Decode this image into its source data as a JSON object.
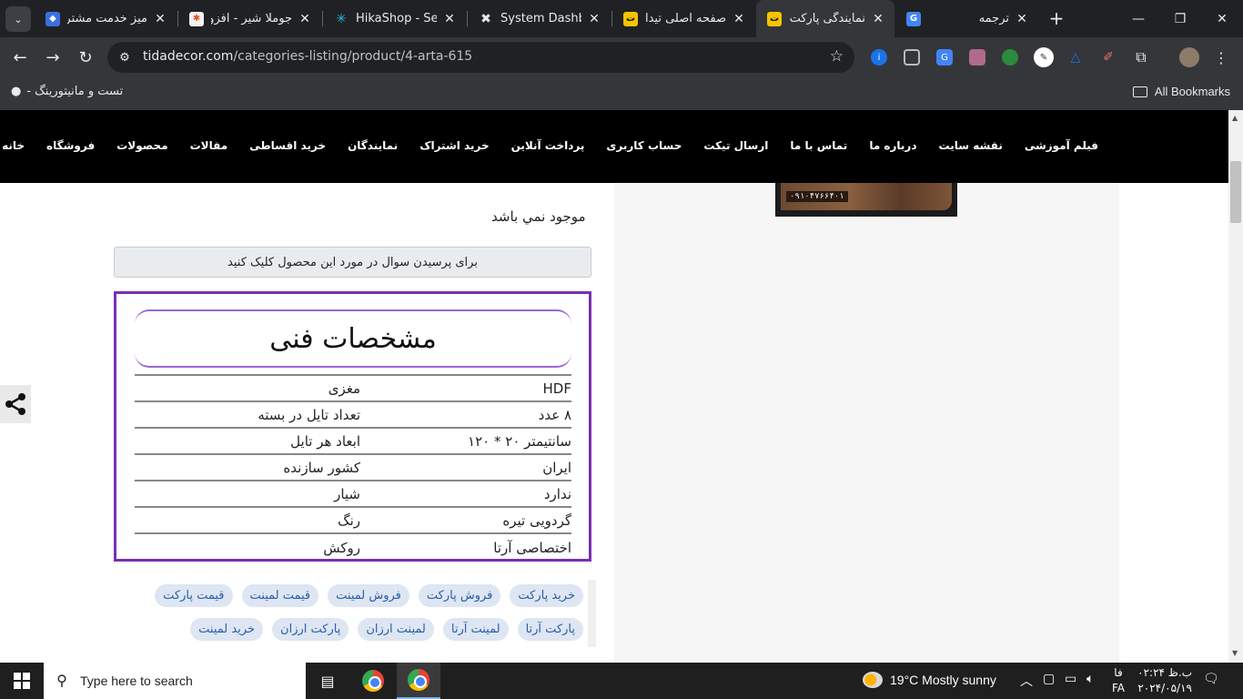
{
  "browser": {
    "tabs": [
      {
        "title": "میز خدمت مشتریان",
        "favicon": "diamond-blue"
      },
      {
        "title": "جوملا شیر - افزونه",
        "favicon": "joomla"
      },
      {
        "title": "HikaShop - Search",
        "favicon": "hikashop"
      },
      {
        "title": "System Dashboard",
        "favicon": "x-logo"
      },
      {
        "title": "صفحه اصلی تیدا",
        "favicon": "tida"
      },
      {
        "title": "نمایندگی پارکت لمینت",
        "favicon": "tida",
        "active": true
      },
      {
        "title": "ترجمه",
        "favicon": "google-translate"
      }
    ],
    "url_host": "tidadecor.com",
    "url_path": "/categories-listing/product/4-arta-615",
    "bookmark": "تست و مانیتورینگ -",
    "all_bookmarks": "All Bookmarks"
  },
  "site": {
    "menu": [
      "خانه",
      "فروشگاه",
      "محصولات",
      "مقالات",
      "خرید اقساطی",
      "نمایندگان",
      "خرید اشتراک",
      "پرداخت آنلاین",
      "حساب کاربری",
      "ارسال تیکت",
      "تماس با ما",
      "درباره ما",
      "نقشه سایت",
      "فیلم آموزشی"
    ],
    "banner_phone": "۰۹۱۰۴۷۶۶۴۰۱"
  },
  "product": {
    "stock_status": "موجود نمي باشد",
    "ask_button": "برای پرسیدن سوال در مورد این محصول کلیک کنید",
    "spec_title": "مشخصات فنی",
    "specs": [
      {
        "key": "مغزی",
        "value": "HDF"
      },
      {
        "key": "تعداد تایل در بسته",
        "value": "۸ عدد"
      },
      {
        "key": "ابعاد هر تایل",
        "value": "سانتیمتر ۲۰ * ۱۲۰"
      },
      {
        "key": "کشور سازنده",
        "value": "ایران"
      },
      {
        "key": "شیار",
        "value": "ندارد"
      },
      {
        "key": "رنگ",
        "value": "گردویی تیره"
      },
      {
        "key": "روکش",
        "value": "اختصاصی آرتا"
      }
    ],
    "tags_row1": [
      "قیمت پارکت",
      "قیمت لمینت",
      "فروش لمینت",
      "فروش پارکت",
      "خرید پارکت"
    ],
    "tags_row2": [
      "خرید لمینت",
      "پارکت ارزان",
      "لمینت ارزان",
      "لمینت آرتا",
      "پارکت آرتا"
    ]
  },
  "taskbar": {
    "search_placeholder": "Type here to search",
    "weather": "19°C  Mostly sunny",
    "lang_top": "فا",
    "lang_bottom": "FA",
    "time": "ب.ظ ۰۲:۲۴",
    "date": "۲۰۲۴/۰۵/۱۹"
  }
}
